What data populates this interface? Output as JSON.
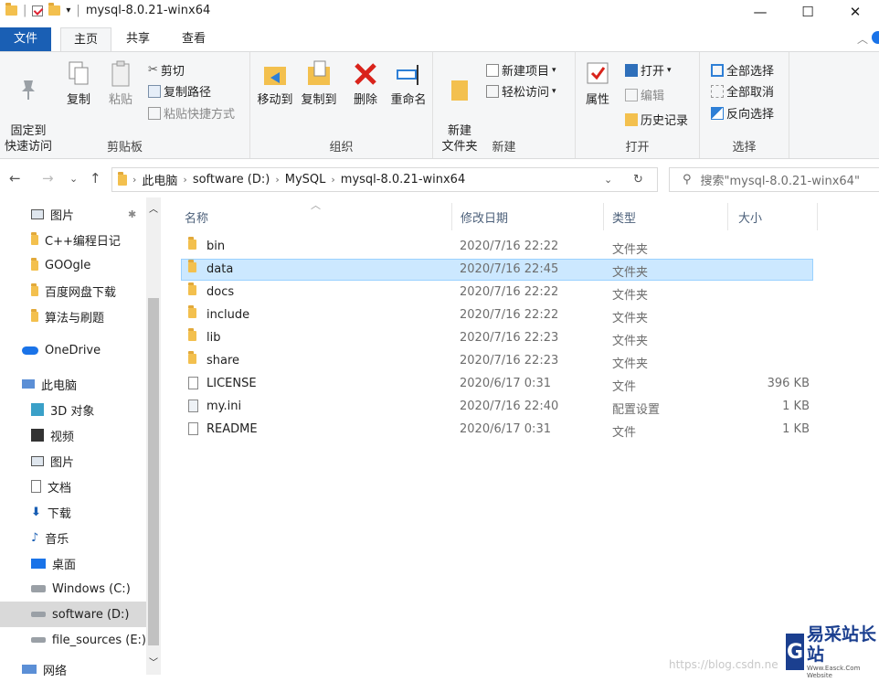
{
  "window": {
    "title": "mysql-8.0.21-winx64",
    "controls": {
      "minimize": "—",
      "maximize": "☐",
      "close": "✕"
    }
  },
  "ribbon_tabs": [
    "文件",
    "主页",
    "共享",
    "查看"
  ],
  "ribbon": {
    "clipboard": {
      "title": "剪贴板",
      "pin": "固定到\n快速访问",
      "copy": "复制",
      "paste": "粘贴",
      "cut": "剪切",
      "copy_path": "复制路径",
      "paste_shortcut": "粘贴快捷方式"
    },
    "organize": {
      "title": "组织",
      "move_to": "移动到",
      "copy_to": "复制到",
      "delete": "删除",
      "rename": "重命名"
    },
    "new": {
      "title": "新建",
      "new_folder": "新建\n文件夹",
      "new_item": "新建项目",
      "easy_access": "轻松访问"
    },
    "open": {
      "title": "打开",
      "properties": "属性",
      "open": "打开",
      "edit": "编辑",
      "history": "历史记录"
    },
    "select": {
      "title": "选择",
      "select_all": "全部选择",
      "select_none": "全部取消",
      "invert": "反向选择"
    }
  },
  "address": {
    "crumbs": [
      "此电脑",
      "software (D:)",
      "MySQL",
      "mysql-8.0.21-winx64"
    ],
    "search_placeholder": "搜索\"mysql-8.0.21-winx64\""
  },
  "nav": {
    "items": [
      {
        "label": "图片",
        "icon": "pictures-icon"
      },
      {
        "label": "C++编程日记",
        "icon": "folder-icon"
      },
      {
        "label": "GOOgle",
        "icon": "folder-icon"
      },
      {
        "label": "百度网盘下载",
        "icon": "folder-icon"
      },
      {
        "label": "算法与刷题",
        "icon": "folder-icon"
      },
      {
        "label": "OneDrive",
        "icon": "cloud-icon"
      },
      {
        "label": "此电脑",
        "icon": "computer-icon"
      },
      {
        "label": "3D 对象",
        "icon": "cube-icon"
      },
      {
        "label": "视频",
        "icon": "video-icon"
      },
      {
        "label": "图片",
        "icon": "pictures-icon"
      },
      {
        "label": "文档",
        "icon": "document-icon"
      },
      {
        "label": "下载",
        "icon": "download-icon"
      },
      {
        "label": "音乐",
        "icon": "music-icon"
      },
      {
        "label": "桌面",
        "icon": "desktop-icon"
      },
      {
        "label": "Windows (C:)",
        "icon": "drive-icon"
      },
      {
        "label": "software (D:)",
        "icon": "drive-icon"
      },
      {
        "label": "file_sources (E:)",
        "icon": "drive-icon"
      },
      {
        "label": "网络",
        "icon": "network-icon"
      }
    ]
  },
  "columns": {
    "name": "名称",
    "date": "修改日期",
    "type": "类型",
    "size": "大小"
  },
  "files": [
    {
      "name": "bin",
      "date": "2020/7/16 22:22",
      "type": "文件夹",
      "size": ""
    },
    {
      "name": "data",
      "date": "2020/7/16 22:45",
      "type": "文件夹",
      "size": ""
    },
    {
      "name": "docs",
      "date": "2020/7/16 22:22",
      "type": "文件夹",
      "size": ""
    },
    {
      "name": "include",
      "date": "2020/7/16 22:22",
      "type": "文件夹",
      "size": ""
    },
    {
      "name": "lib",
      "date": "2020/7/16 22:23",
      "type": "文件夹",
      "size": ""
    },
    {
      "name": "share",
      "date": "2020/7/16 22:23",
      "type": "文件夹",
      "size": ""
    },
    {
      "name": "LICENSE",
      "date": "2020/6/17 0:31",
      "type": "文件",
      "size": "396 KB"
    },
    {
      "name": "my.ini",
      "date": "2020/7/16 22:40",
      "type": "配置设置",
      "size": "1 KB"
    },
    {
      "name": "README",
      "date": "2020/6/17 0:31",
      "type": "文件",
      "size": "1 KB"
    }
  ],
  "watermark": {
    "logo": "G",
    "text": "易采站长站",
    "sub": "Www.Easck.Com Website",
    "url": "https://blog.csdn.ne"
  }
}
